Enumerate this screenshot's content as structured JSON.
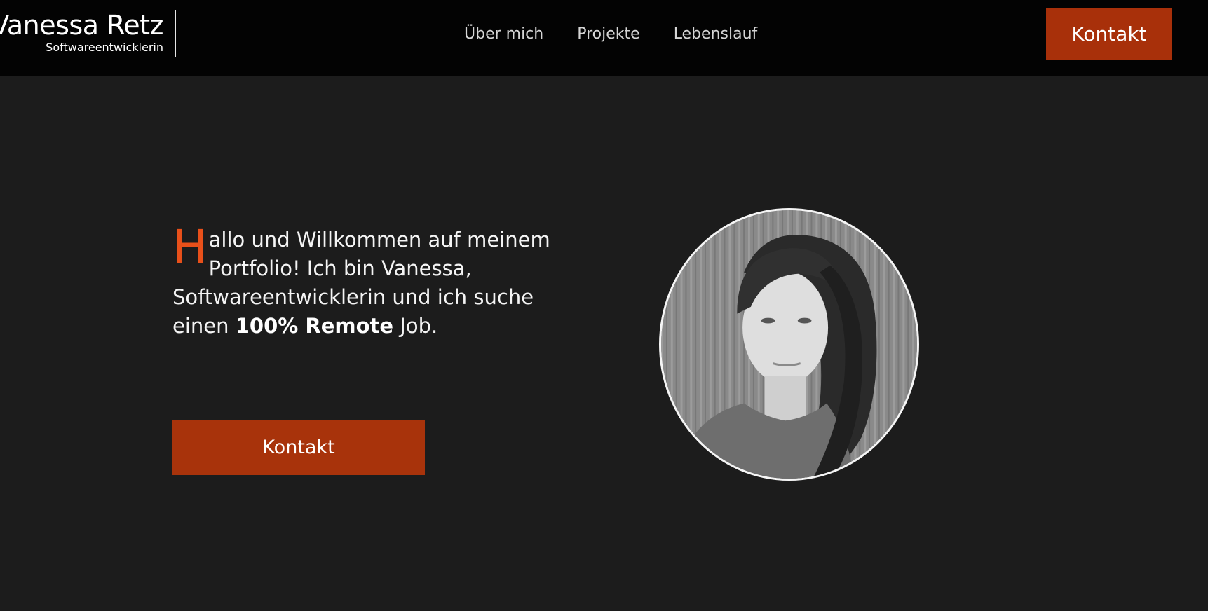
{
  "header": {
    "brand_name": "Vanessa Retz",
    "brand_subtitle": "Softwareentwicklerin",
    "nav": [
      {
        "label": "Über mich"
      },
      {
        "label": "Projekte"
      },
      {
        "label": "Lebenslauf"
      }
    ],
    "cta_label": "Kontakt"
  },
  "hero": {
    "dropcap": "H",
    "text_part1": "allo und Willkommen auf meinem Portfolio! Ich bin Vanessa, Softwareentwicklerin und ich suche einen ",
    "text_bold": "100% Remote",
    "text_part2": " Job.",
    "cta_label": "Kontakt",
    "portrait_icon": "portrait-photo"
  },
  "colors": {
    "accent": "#a8300a",
    "dropcap": "#e8501a",
    "header_bg": "#030303",
    "page_bg": "#1c1c1c"
  }
}
